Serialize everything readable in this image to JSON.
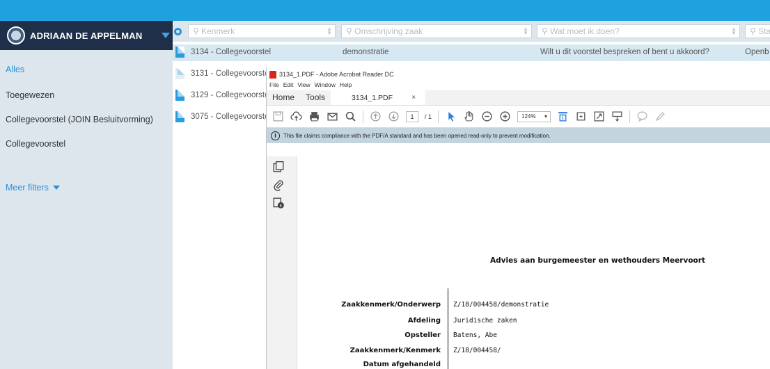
{
  "user": {
    "name": "ADRIAAN DE APPELMAN"
  },
  "sidebar": {
    "filters": [
      {
        "label": "Alles",
        "active": true
      },
      {
        "label": "Toegewezen",
        "active": false
      },
      {
        "label": "Collegevoorstel (JOIN Besluitvorming)",
        "active": false
      },
      {
        "label": "Collegevoorstel",
        "active": false
      }
    ],
    "more_filters": "Meer filters"
  },
  "search": {
    "kenmerk": "Kenmerk",
    "omschrijving": "Omschrijving zaak",
    "wat_moet": "Wat moet ik doen?",
    "status": "Sta"
  },
  "rows": [
    {
      "kenmerk": "3134 - Collegevoorstel",
      "omschrijving": "demonstratie",
      "actie": "Wilt u dit voorstel bespreken of bent u akkoord?",
      "status": "Openb",
      "selected": true
    },
    {
      "kenmerk": "3131 - Collegevoorstel",
      "selected": false
    },
    {
      "kenmerk": "3129 - Collegevoorstel",
      "selected": false
    },
    {
      "kenmerk": "3075 - Collegevoorstel",
      "selected": false
    }
  ],
  "acrobat": {
    "window_title": "3134_1.PDF - Adobe Acrobat Reader DC",
    "menu": [
      "File",
      "Edit",
      "View",
      "Window",
      "Help"
    ],
    "tabs": {
      "home": "Home",
      "tools": "Tools",
      "doc": "3134_1.PDF",
      "close": "×"
    },
    "page_current": "1",
    "page_total": "/ 1",
    "zoom": "124%",
    "info_bar": "This file claims compliance with the PDF/A standard and has been opened read-only to prevent modification."
  },
  "document": {
    "heading": "Advies aan burgemeester en wethouders Meervoort",
    "fields": [
      {
        "label": "Zaakkenmerk/Onderwerp",
        "value": "Z/18/004458/demonstratie"
      },
      {
        "label": "Afdeling",
        "value": "Juridische zaken"
      },
      {
        "label": "Opsteller",
        "value": "Batens, Abe"
      },
      {
        "label": "Zaakkenmerk/Kenmerk",
        "value": "Z/18/004458/"
      },
      {
        "label": "Datum afgehandeld",
        "value": ""
      }
    ]
  }
}
